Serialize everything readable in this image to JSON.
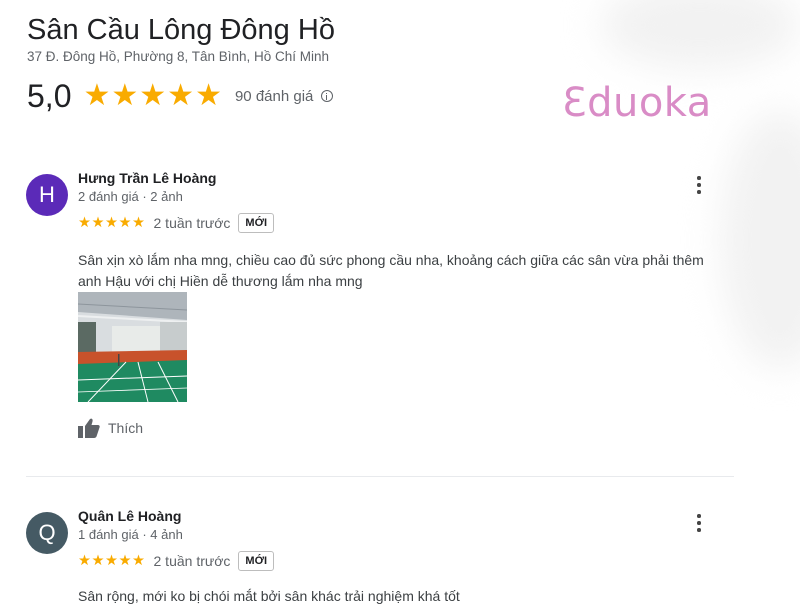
{
  "place": {
    "name": "Sân Cầu Lông Đông Hồ",
    "address": "37 Đ. Đông Hồ, Phường 8, Tân Bình, Hồ Chí Minh",
    "rating": "5,0",
    "rating_stars": "★★★★★",
    "review_count": "90 đánh giá",
    "info_icon": "info-icon"
  },
  "watermark": {
    "text": "Ɛduoka",
    "color": "#d98cc6"
  },
  "reviews": [
    {
      "avatar_letter": "H",
      "avatar_color": "#5b2ab8",
      "name": "Hưng Trần Lê Hoàng",
      "meta": "2 đánh giá · 2 ảnh",
      "stars": "★★★★★",
      "time": "2 tuần trước",
      "badge": "MỚI",
      "text": "Sân xịn xò lắm nha mng, chiều cao đủ sức phong cầu nha, khoảng cách giữa các sân vừa phải thêm anh Hậu với chị Hiền dễ thương lắm nha mng",
      "like_label": "Thích",
      "has_photo": true
    },
    {
      "avatar_letter": "Q",
      "avatar_color": "#455a64",
      "name": "Quân Lê Hoàng",
      "meta": "1 đánh giá · 4 ảnh",
      "stars": "★★★★★",
      "time": "2 tuần trước",
      "badge": "MỚI",
      "text": "Sân rộng, mới ko bị chói mắt bởi sân khác trải nghiệm khá tốt"
    }
  ],
  "colors": {
    "star": "#f9ab00",
    "text_primary": "#202124",
    "text_secondary": "#5f6368"
  }
}
